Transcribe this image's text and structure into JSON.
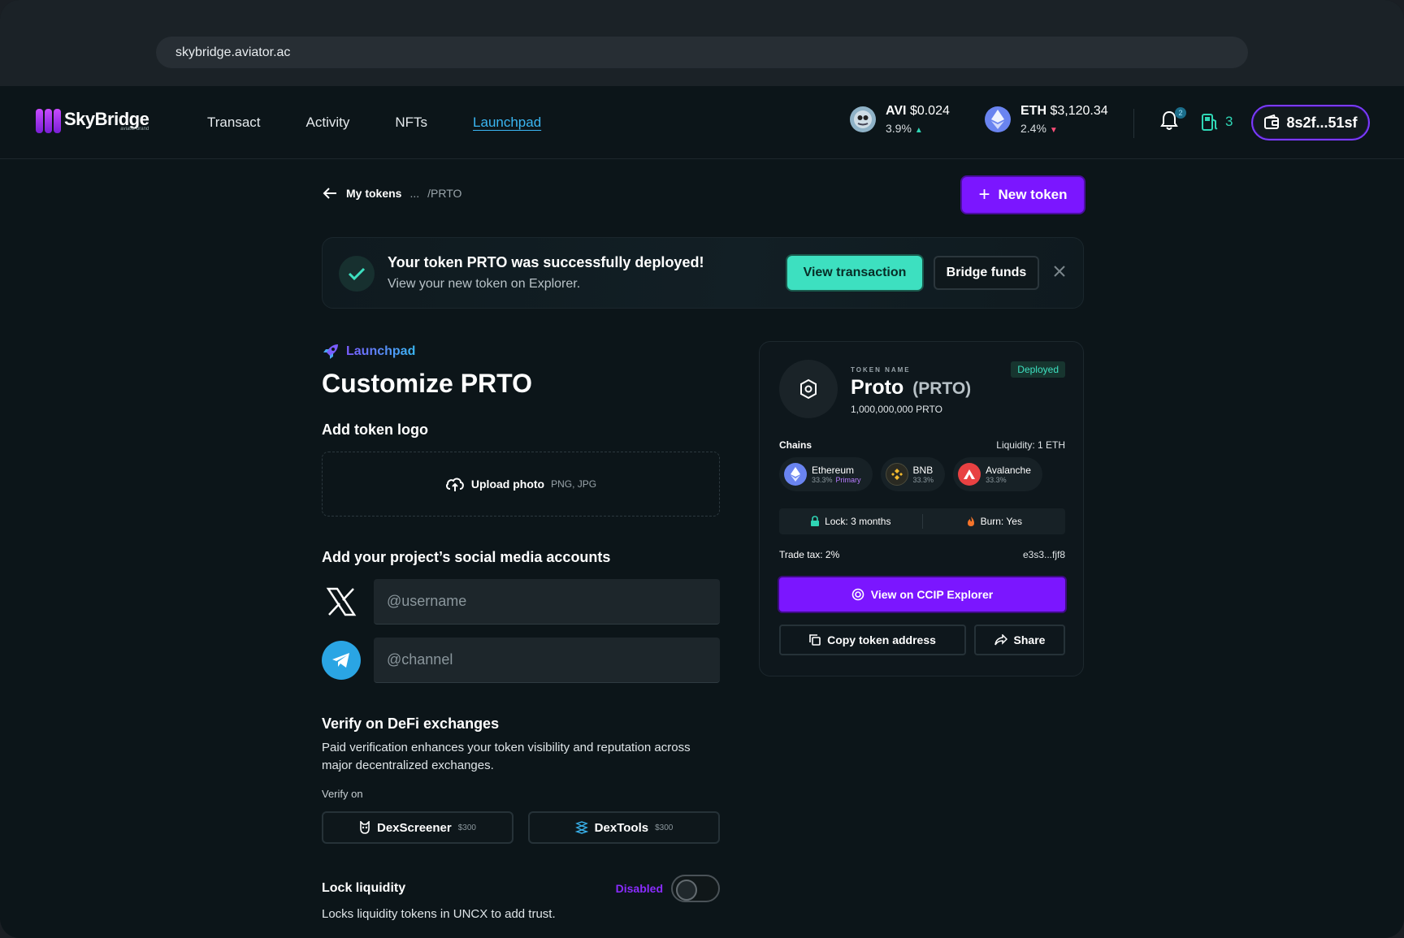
{
  "browser": {
    "url": "skybridge.aviator.ac"
  },
  "header": {
    "brand": "SkyBridge",
    "brand_sub": "aviator brand",
    "nav": [
      "Transact",
      "Activity",
      "NFTs",
      "Launchpad"
    ],
    "tickers": [
      {
        "symbol": "AVI",
        "price": "$0.024",
        "change": "3.9%",
        "direction": "up"
      },
      {
        "symbol": "ETH",
        "price": "$3,120.34",
        "change": "2.4%",
        "direction": "down"
      }
    ],
    "notification_count": "2",
    "gas_value": "3",
    "wallet_address": "8s2f...51sf"
  },
  "breadcrumb": {
    "back": "My tokens",
    "ellipsis": "...",
    "current": "/PRTO"
  },
  "new_token_label": "New token",
  "banner": {
    "title": "Your token PRTO was successfully deployed!",
    "subtitle": "View your new token on Explorer.",
    "view_label": "View transaction",
    "bridge_label": "Bridge funds"
  },
  "form": {
    "tag": "Launchpad",
    "title": "Customize PRTO",
    "logo_heading": "Add token logo",
    "upload_label": "Upload photo",
    "upload_formats": "PNG, JPG",
    "social_heading": "Add your project’s social media accounts",
    "x_placeholder": "@username",
    "telegram_placeholder": "@channel",
    "verify_heading": "Verify on DeFi exchanges",
    "verify_desc": "Paid verification enhances your token visibility and reputation across major decentralized exchanges.",
    "verify_on": "Verify on",
    "exchanges": [
      {
        "name": "DexScreener",
        "price": "$300"
      },
      {
        "name": "DexTools",
        "price": "$300"
      }
    ],
    "lock_heading": "Lock liquidity",
    "lock_state": "Disabled",
    "lock_desc": "Locks liquidity tokens in UNCX to add trust."
  },
  "card": {
    "label": "TOKEN NAME",
    "name": "Proto",
    "symbol": "(PRTO)",
    "supply": "1,000,000,000 PRTO",
    "status": "Deployed",
    "chains_heading": "Chains",
    "liquidity": "Liquidity: 1 ETH",
    "chains": [
      {
        "name": "Ethereum",
        "share": "33.3%",
        "tag": "Primary"
      },
      {
        "name": "BNB",
        "share": "33.3%",
        "tag": ""
      },
      {
        "name": "Avalanche",
        "share": "33.3%",
        "tag": ""
      }
    ],
    "lock": "Lock: 3 months",
    "burn": "Burn: Yes",
    "trade_tax": "Trade tax: 2%",
    "address": "e3s3...fjf8",
    "ccip_label": "View on CCIP Explorer",
    "copy_label": "Copy token address",
    "share_label": "Share"
  },
  "colors": {
    "accent": "#7b16ff",
    "teal": "#3de0c0",
    "link": "#3ab6f2"
  }
}
